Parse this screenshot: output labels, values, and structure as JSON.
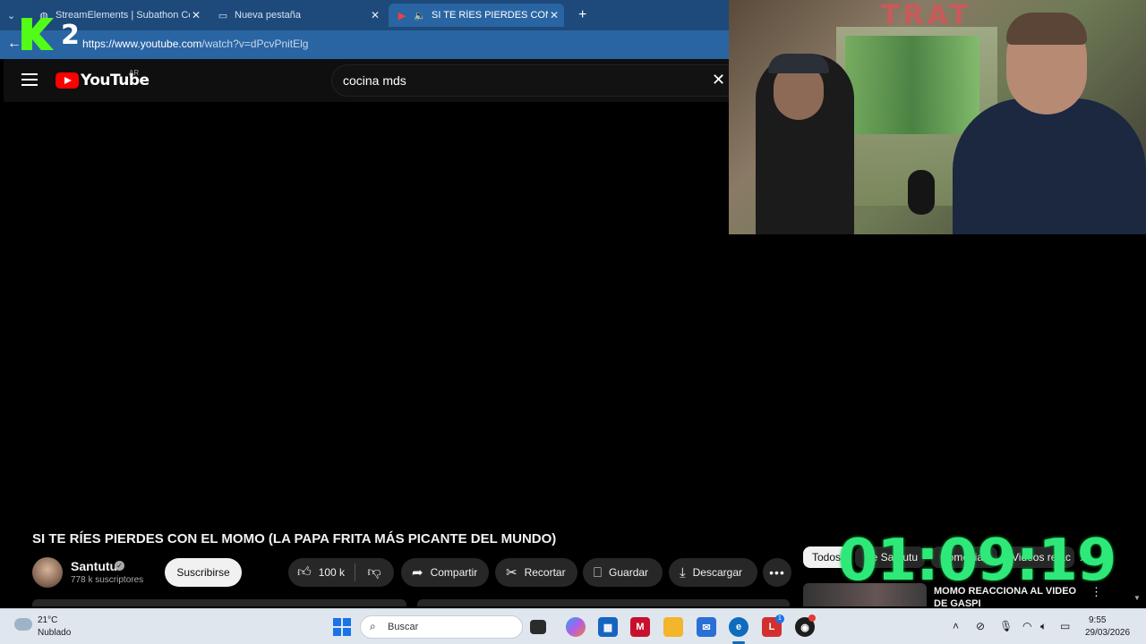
{
  "browser": {
    "tabs": [
      {
        "label": "StreamElements | Subathon Count",
        "icon": "globe-icon"
      },
      {
        "label": "Nueva pestaña",
        "icon": "page-icon"
      },
      {
        "label": "SI TE RÍES PIERDES CON EL M",
        "icon": "youtube-icon"
      }
    ],
    "new_tab": "+",
    "url_host": "https://www.youtube.com",
    "url_path": "/watch?v=dPcvPnitElg"
  },
  "overlay": {
    "logo_number": "2",
    "timer": "01:09:19",
    "webcam_sign": "TRAT"
  },
  "youtube": {
    "logo_text": "YouTube",
    "country_code": "AR",
    "search_value": "cocina mds",
    "video_title": "SI TE RÍES PIERDES CON EL MOMO (LA PAPA FRITA MÁS PICANTE DEL MUNDO)",
    "channel_name": "Santutu",
    "subscribers": "778 k suscriptores",
    "subscribe_label": "Suscribirse",
    "likes": "100 k",
    "share_label": "Compartir",
    "clip_label": "Recortar",
    "save_label": "Guardar",
    "download_label": "Descargar",
    "more_label": "•••",
    "chips": [
      "Todos",
      "De Santutu",
      "Comedias",
      "Videos relac"
    ],
    "recommended_title": "MOMO REACCIONA AL VIDEO DE GASPI"
  },
  "taskbar": {
    "temperature": "21°C",
    "weather": "Nublado",
    "search_placeholder": "Buscar",
    "badge_count": "1",
    "time": "9:55",
    "date": "29/03/2026"
  }
}
